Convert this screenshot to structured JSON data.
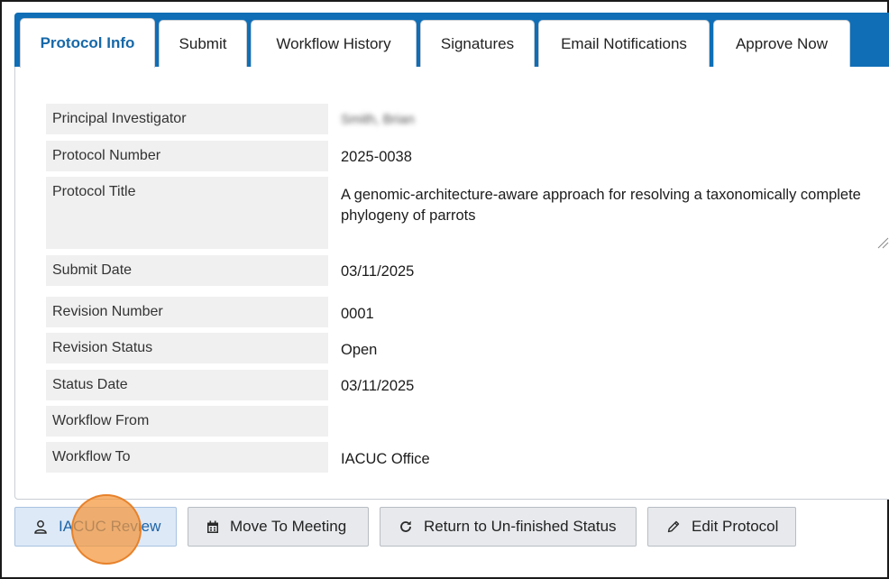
{
  "tabs": [
    {
      "label": "Protocol Info",
      "active": true
    },
    {
      "label": "Submit",
      "active": false
    },
    {
      "label": "Workflow History",
      "active": false
    },
    {
      "label": "Signatures",
      "active": false
    },
    {
      "label": "Email Notifications",
      "active": false
    },
    {
      "label": "Approve Now",
      "active": false
    }
  ],
  "fields": {
    "principal_investigator": {
      "label": "Principal Investigator",
      "value": "Smith, Brian"
    },
    "protocol_number": {
      "label": "Protocol Number",
      "value": "2025-0038"
    },
    "protocol_title": {
      "label": "Protocol Title",
      "value": "A genomic-architecture-aware approach for resolving a taxonomically complete phylogeny of parrots"
    },
    "submit_date": {
      "label": "Submit Date",
      "value": "03/11/2025"
    },
    "revision_number": {
      "label": "Revision Number",
      "value": "0001"
    },
    "revision_status": {
      "label": "Revision Status",
      "value": "Open"
    },
    "status_date": {
      "label": "Status Date",
      "value": "03/11/2025"
    },
    "workflow_from": {
      "label": "Workflow From",
      "value": ""
    },
    "workflow_to": {
      "label": "Workflow To",
      "value": "IACUC Office"
    }
  },
  "actions": {
    "iacuc_review": "IACUC Review",
    "move_to_meeting": "Move To Meeting",
    "return_unfinished": "Return to Un-finished Status",
    "edit_protocol": "Edit Protocol"
  },
  "icons": {
    "iacuc_review": "user-icon",
    "move_to_meeting": "calendar-icon",
    "return_unfinished": "redo-icon",
    "edit_protocol": "pencil-icon"
  },
  "colors": {
    "tab_bar": "#0f6eb6",
    "active_tab_text": "#1668a8",
    "primary_button_bg": "#dde9f7",
    "click_marker": "#f4963a"
  }
}
